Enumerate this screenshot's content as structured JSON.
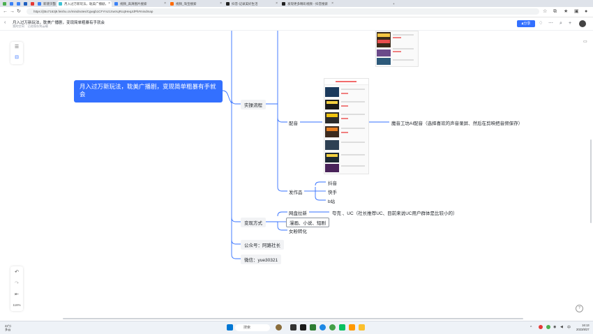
{
  "browser": {
    "tabs": [
      {
        "label": "",
        "color": "#4caf50"
      },
      {
        "label": "",
        "color": "#3b82f6"
      },
      {
        "label": "",
        "color": "#3b82f6"
      },
      {
        "label": "",
        "color": "#1f5fbf"
      },
      {
        "label": "",
        "color": "#e53935"
      },
      {
        "label": "新建页面",
        "color": "#3b82f6"
      },
      {
        "label": "月入过万新玩法，耽美广播剧，",
        "color": "#3ec1d3"
      },
      {
        "label": "视频_高清图片搜索",
        "color": "#3b82f6"
      },
      {
        "label": "视频_淘宝搜索",
        "color": "#ff6a00"
      },
      {
        "label": "抖音-记录美好生活",
        "color": "#222222"
      },
      {
        "label": "发现更多精彩视频 - 抖音搜索",
        "color": "#222222"
      }
    ],
    "new_tab": "+",
    "url": "https://jt5o7163j9.feishu.cn/mindnotes/Cgwgb1CFYmz1XwXqRcqtHeqJdPh#mindmap"
  },
  "doc": {
    "title": "月入过万新玩法，耽美广播剧，变现简单粗暴有手就会",
    "meta_left": "我的空间",
    "meta_right": "已经保存到云端",
    "share_label": "分享"
  },
  "mindmap": {
    "root": "月入过万新玩法，耽美广播剧，变现简单粗暴有手就会",
    "branch_process": "实操流程",
    "dubbing": "配音",
    "dubbing_note": "魔音工坊AI配音（选择喜欢的声音录屏、然后在剪映把音频保存）",
    "publish": "发作品",
    "platforms": [
      "抖音",
      "快手",
      "b站"
    ],
    "branch_monetize": "变现方式",
    "netdisk": "网盘拉新",
    "netdisk_note": "夸克 、UC（社长推荐UC、目前来说UC用户群体是比较小的）",
    "short_drama": "漫画、小说、短剧",
    "fan_convert": "女粉转化",
    "wechat_public": "公众号：阿路社长",
    "wechat": "微信：yue30321"
  },
  "toolbar": {
    "zoom": "118%",
    "undo": "↶",
    "redo": "↷",
    "format_painter": "⇤"
  },
  "taskbar": {
    "search_placeholder": "搜索",
    "weather_temp": "22°C",
    "weather_desc": "多云",
    "time": "16:13",
    "date": "2023/8/27"
  }
}
